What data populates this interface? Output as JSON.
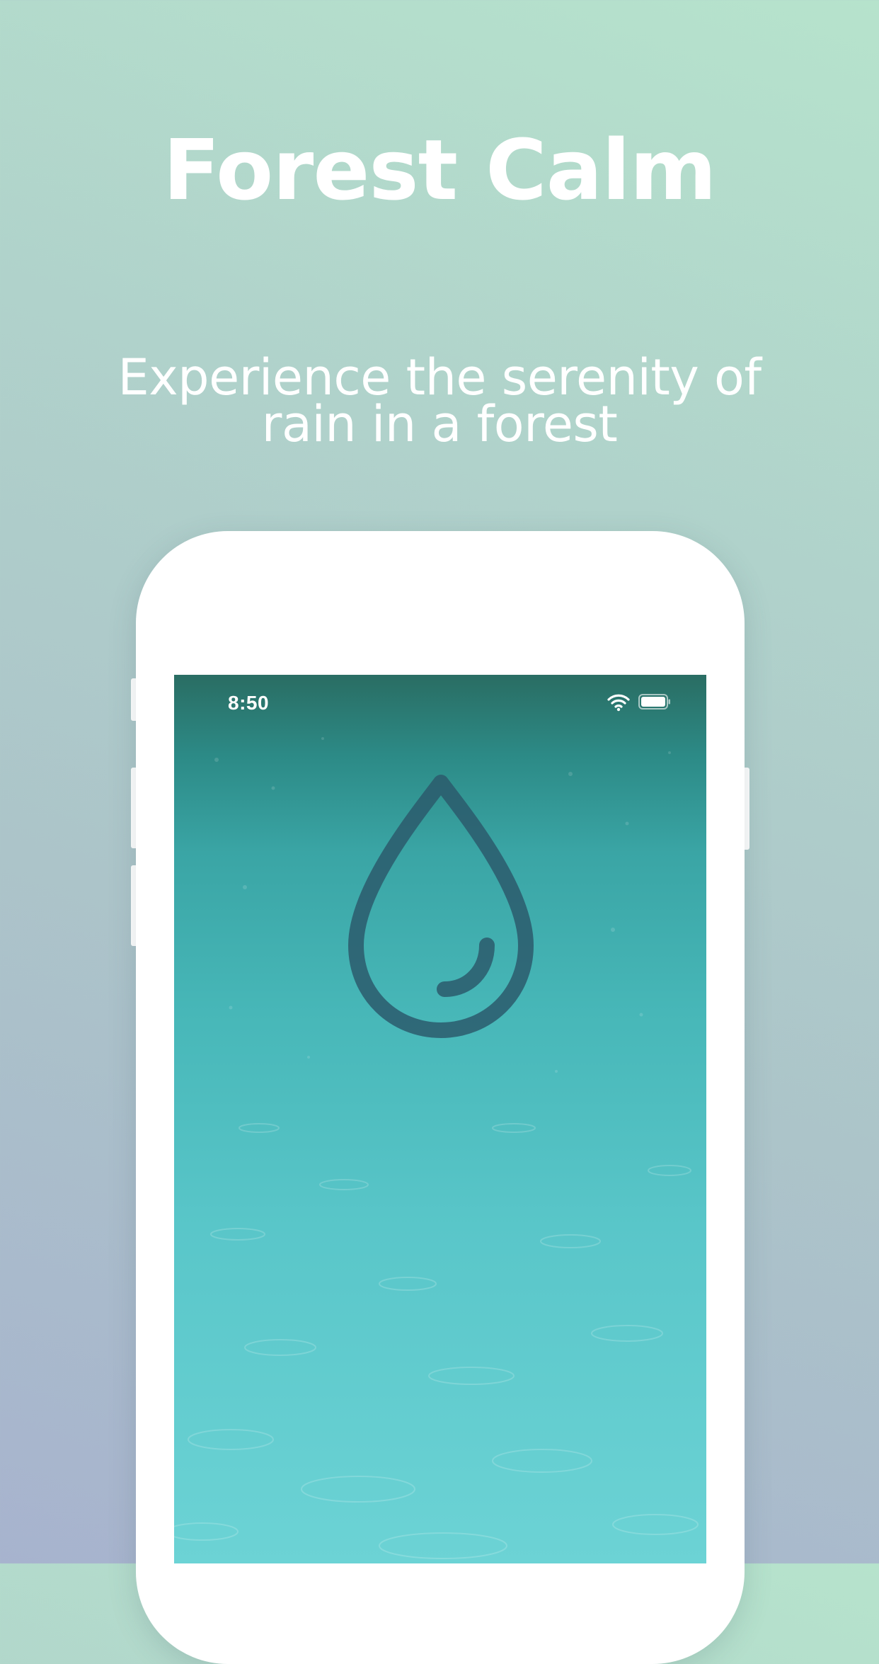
{
  "headline": "Forest Calm",
  "subtitle_lines": [
    "Experience the serenity of",
    "rain in a forest"
  ],
  "device": {
    "status_time": "8:50",
    "icons": {
      "wifi": "wifi-icon",
      "battery": "battery-icon",
      "drop": "water-drop-icon"
    }
  },
  "colors": {
    "background_top": "#b6e3cc",
    "background_bottom": "#a7b3ce",
    "drop_stroke": "#2c5b6c",
    "water": "#47b7b8"
  }
}
